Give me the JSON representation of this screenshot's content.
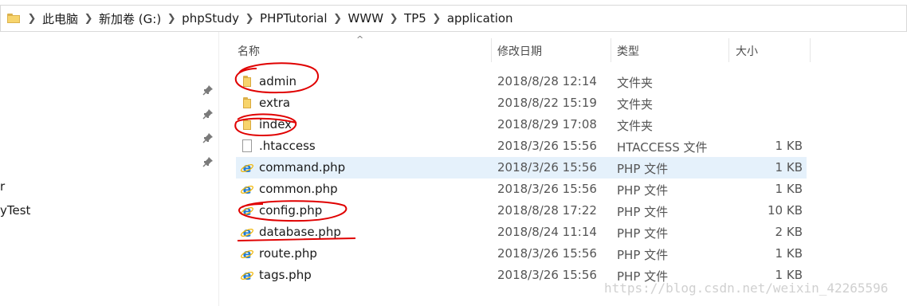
{
  "breadcrumb": [
    "此电脑",
    "新加卷 (G:)",
    "phpStudy",
    "PHPTutorial",
    "WWW",
    "TP5",
    "application"
  ],
  "nav": {
    "truncated_items": [
      "r",
      "yTest"
    ],
    "pin_icon": "pin-icon"
  },
  "columns": {
    "name": "名称",
    "date": "修改日期",
    "type": "类型",
    "size": "大小"
  },
  "files": [
    {
      "name": "admin",
      "date": "2018/8/28 12:14",
      "type": "文件夹",
      "size": "",
      "icon": "folder-icon"
    },
    {
      "name": "extra",
      "date": "2018/8/22 15:19",
      "type": "文件夹",
      "size": "",
      "icon": "folder-icon"
    },
    {
      "name": "index",
      "date": "2018/8/29 17:08",
      "type": "文件夹",
      "size": "",
      "icon": "folder-icon"
    },
    {
      "name": ".htaccess",
      "date": "2018/3/26 15:56",
      "type": "HTACCESS 文件",
      "size": "1 KB",
      "icon": "file-icon"
    },
    {
      "name": "command.php",
      "date": "2018/3/26 15:56",
      "type": "PHP 文件",
      "size": "1 KB",
      "icon": "ie-icon",
      "selected": true
    },
    {
      "name": "common.php",
      "date": "2018/3/26 15:56",
      "type": "PHP 文件",
      "size": "1 KB",
      "icon": "ie-icon"
    },
    {
      "name": "config.php",
      "date": "2018/8/28 17:22",
      "type": "PHP 文件",
      "size": "10 KB",
      "icon": "ie-icon"
    },
    {
      "name": "database.php",
      "date": "2018/8/24 11:14",
      "type": "PHP 文件",
      "size": "2 KB",
      "icon": "ie-icon"
    },
    {
      "name": "route.php",
      "date": "2018/3/26 15:56",
      "type": "PHP 文件",
      "size": "1 KB",
      "icon": "ie-icon"
    },
    {
      "name": "tags.php",
      "date": "2018/3/26 15:56",
      "type": "PHP 文件",
      "size": "1 KB",
      "icon": "ie-icon"
    }
  ],
  "watermark": "https://blog.csdn.net/weixin_42265596",
  "colors": {
    "selection": "#e5f1fb",
    "folder": "#f7d46c",
    "annotation": "#e00000",
    "ie_blue": "#1e7bd6"
  }
}
